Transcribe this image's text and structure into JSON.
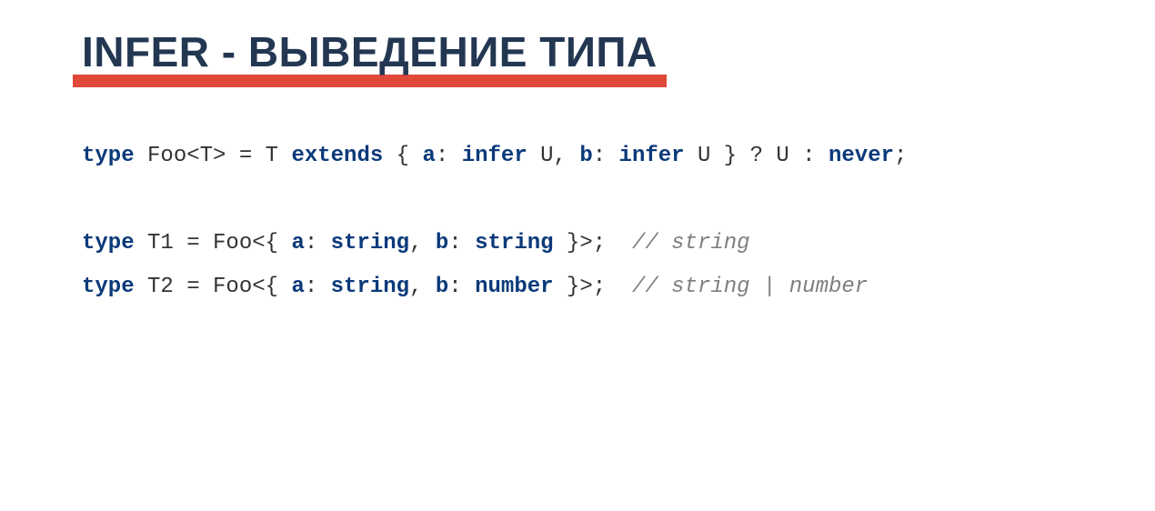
{
  "title": "INFER - ВЫВЕДЕНИЕ ТИПА",
  "code": {
    "line1": {
      "kw_type": "type",
      "foo_t": " Foo<T> = T ",
      "kw_extends": "extends",
      "brace_open": " { ",
      "prop_a": "a",
      "colon1": ": ",
      "kw_infer1": "infer",
      "u1": " U, ",
      "prop_b": "b",
      "colon2": ": ",
      "kw_infer2": "infer",
      "u2": " U } ? U : ",
      "kw_never": "never",
      "semi": ";"
    },
    "line2": {
      "kw_type": "type",
      "t1": " T1 = Foo<{ ",
      "prop_a": "a",
      "colon1": ": ",
      "kw_string1": "string",
      "comma": ", ",
      "prop_b": "b",
      "colon2": ": ",
      "kw_string2": "string",
      "close": " }>;  ",
      "comment": "// string"
    },
    "line3": {
      "kw_type": "type",
      "t2": " T2 = Foo<{ ",
      "prop_a": "a",
      "colon1": ": ",
      "kw_string": "string",
      "comma": ", ",
      "prop_b": "b",
      "colon2": ": ",
      "kw_number": "number",
      "close": " }>;  ",
      "comment": "// string | number"
    }
  }
}
